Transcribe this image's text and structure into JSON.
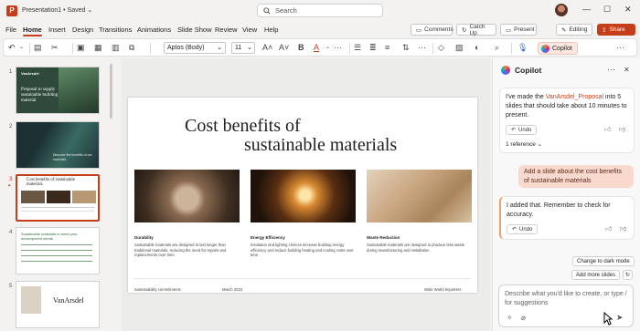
{
  "titlebar": {
    "app_letter": "P",
    "doc_title": "Presentation1 • Saved ⌄",
    "search_placeholder": "Search",
    "min": "—",
    "max": "☐",
    "close": "✕"
  },
  "menu": {
    "items": [
      "File",
      "Home",
      "Insert",
      "Design",
      "Transitions",
      "Animations",
      "Slide Show",
      "Review",
      "View",
      "Help"
    ],
    "active": "Home",
    "comments": "Comments",
    "catchup": "Catch Up",
    "present": "Present",
    "editing": "Editing",
    "share": "Share"
  },
  "toolbar": {
    "font": "Aptos (Body)",
    "size": "11",
    "bold": "B",
    "italic": "I",
    "underline": "U",
    "fontcolor": "A",
    "copilot": "Copilot"
  },
  "thumbs": {
    "numbers": [
      "1",
      "2",
      "3",
      "4",
      "5"
    ],
    "t1_brand": "VanArsdel",
    "t1_title": "Proposal to supply sustainable building material",
    "t2_text": "Discover the benefits of our materials",
    "t3_title": "Cost benefits of sustainable materials",
    "t4_title": "Sustainable materials to meet your development needs",
    "t5_brand": "VanArsdel"
  },
  "slide": {
    "title_line1": "Cost benefits of",
    "title_line2": "sustainable materials",
    "cols": [
      {
        "head": "Durability",
        "body": "Sustainable materials are designed to last longer than traditional materials, reducing the need for repairs and replacements over time."
      },
      {
        "head": "Energy Efficiency",
        "body": "Insulation and lighting choices increase building energy efficiency and reduce building heating and cooling costs over time."
      },
      {
        "head": "Waste Reduction",
        "body": "Sustainable materials are designed to produce less waste during manufacturing and installation."
      }
    ],
    "footer_left": "Sustainability commitments",
    "footer_mid": "March 2023",
    "footer_right": "Wide World Importers"
  },
  "copilot": {
    "title": "Copilot",
    "more": "···",
    "close": "✕",
    "msg1_pre": "I've made the ",
    "msg1_link": "VanArsdel_Proposal",
    "msg1_post": " into 5 slides that should take about 10 minutes to present.",
    "undo": "Undo",
    "reference": "1 reference ⌄",
    "user_msg": "Add a slide about the cost benefits of sustainable materials",
    "msg2": "I added that. Remember to check for accuracy.",
    "sugg1": "Change to dark mode",
    "sugg2": "Add more slides",
    "input_placeholder": "Describe what you'd like to create, or type / for suggestions"
  },
  "colors": {
    "accent": "#c43e1c",
    "bubble": "#f9d9cd"
  }
}
